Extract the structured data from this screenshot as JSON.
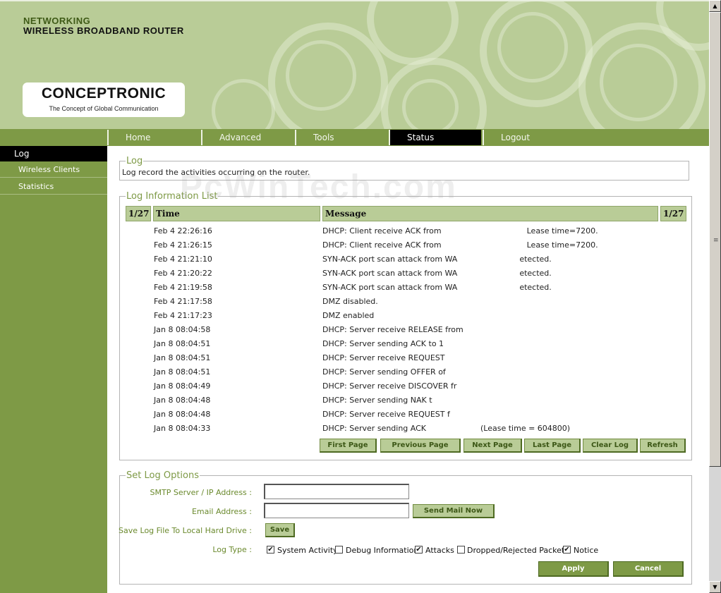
{
  "header": {
    "brand_line1": "NETWORKING",
    "brand_line2": "WIRELESS BROADBAND ROUTER",
    "logo_name": "CONCEPTRONIC",
    "logo_tagline": "The Concept of Global Communication"
  },
  "nav": {
    "tabs": [
      {
        "label": "Home"
      },
      {
        "label": "Advanced"
      },
      {
        "label": "Tools"
      },
      {
        "label": "Status",
        "active": true
      },
      {
        "label": "Logout"
      }
    ]
  },
  "sidebar": {
    "items": [
      {
        "label": "Log",
        "active": true
      },
      {
        "label": "Wireless Clients"
      },
      {
        "label": "Statistics"
      }
    ]
  },
  "log_section": {
    "legend": "Log",
    "description": "Log record the activities occurring on the router."
  },
  "list_section": {
    "legend": "Log Information List",
    "page_left": "1/27",
    "page_right": "1/27",
    "col_time": "Time",
    "col_message": "Message",
    "rows": [
      {
        "time": "Feb 4 22:26:16",
        "message": "DHCP: Client receive ACK from           Lease time=7200."
      },
      {
        "time": "Feb 4 21:26:15",
        "message": "DHCP: Client receive ACK from           Lease time=7200."
      },
      {
        "time": "Feb 4 21:21:10",
        "message": "SYN-ACK port scan attack from WA        etected."
      },
      {
        "time": "Feb 4 21:20:22",
        "message": "SYN-ACK port scan attack from WA        etected."
      },
      {
        "time": "Feb 4 21:19:58",
        "message": "SYN-ACK port scan attack from WA        etected."
      },
      {
        "time": "Feb 4 21:17:58",
        "message": "DMZ disabled."
      },
      {
        "time": "Feb 4 21:17:23",
        "message": "DMZ enabled"
      },
      {
        "time": "Jan 8 08:04:58",
        "message": "DHCP: Server receive RELEASE from"
      },
      {
        "time": "Jan 8 08:04:51",
        "message": "DHCP: Server sending ACK to 1"
      },
      {
        "time": "Jan 8 08:04:51",
        "message": "DHCP: Server receive REQUEST"
      },
      {
        "time": "Jan 8 08:04:51",
        "message": "DHCP: Server sending OFFER of"
      },
      {
        "time": "Jan 8 08:04:49",
        "message": "DHCP: Server receive DISCOVER fr"
      },
      {
        "time": "Jan 8 08:04:48",
        "message": "DHCP: Server sending NAK t"
      },
      {
        "time": "Jan 8 08:04:48",
        "message": "DHCP: Server receive REQUEST f"
      },
      {
        "time": "Jan 8 08:04:33",
        "message": "DHCP: Server sending ACK       (Lease time = 604800)"
      }
    ],
    "buttons": {
      "first": "First Page",
      "previous": "Previous Page",
      "next": "Next Page",
      "last": "Last Page",
      "clear": "Clear Log",
      "refresh": "Refresh"
    }
  },
  "options_section": {
    "legend": "Set Log Options",
    "smtp_label": "SMTP Server / IP Address :",
    "smtp_value": "",
    "email_label": "Email Address :",
    "email_value": "",
    "send_mail_button": "Send Mail Now",
    "save_label": "Save Log File To Local Hard Drive :",
    "save_button": "Save",
    "logtype_label": "Log Type :",
    "log_types": [
      {
        "label": "System Activity",
        "checked": true
      },
      {
        "label": "Debug Information",
        "checked": false
      },
      {
        "label": "Attacks",
        "checked": true
      },
      {
        "label": "Dropped/Rejected Packets",
        "checked": false
      },
      {
        "label": "Notice",
        "checked": true
      }
    ],
    "apply_button": "Apply",
    "cancel_button": "Cancel"
  },
  "watermark": "PcWinTech.com",
  "colors": {
    "accent_green": "#7e9a46",
    "light_green": "#b9cc97",
    "active_black": "#000000"
  }
}
